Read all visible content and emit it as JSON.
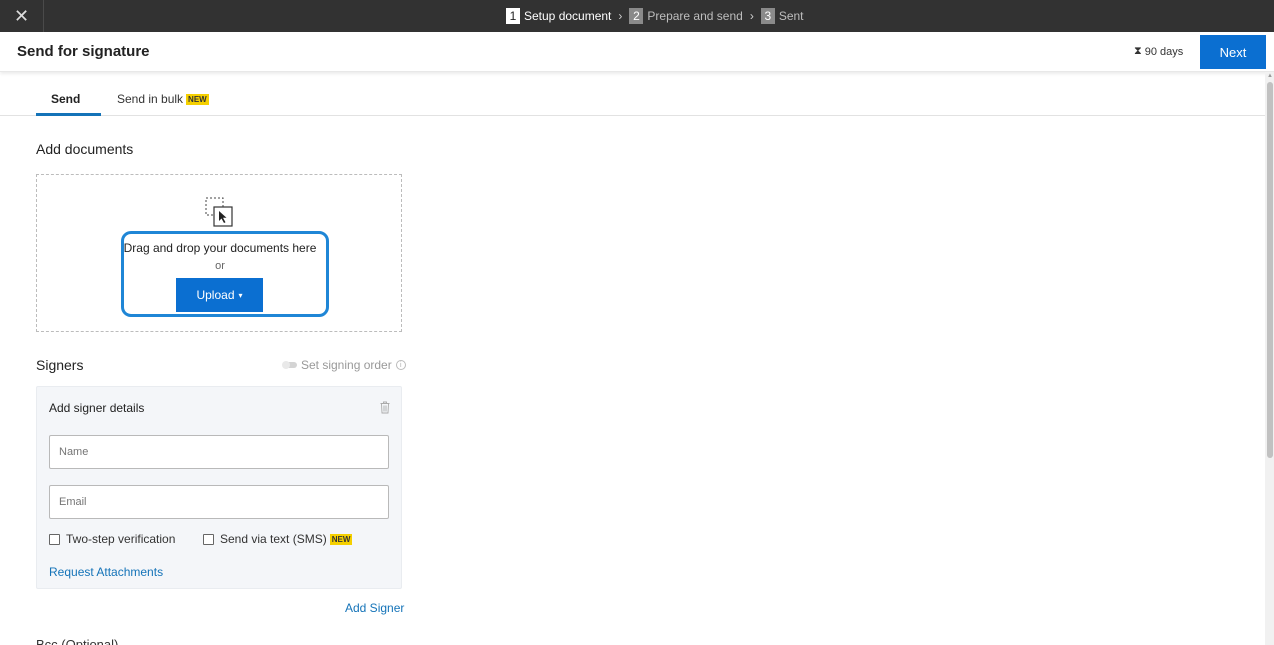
{
  "topbar": {
    "close_icon": "close-icon",
    "steps": [
      {
        "num": "1",
        "label": "Setup document"
      },
      {
        "num": "2",
        "label": "Prepare and send"
      },
      {
        "num": "3",
        "label": "Sent"
      }
    ],
    "separator": "›"
  },
  "header": {
    "title": "Send for signature",
    "expiry_icon": "hourglass-icon",
    "expiry": "90 days",
    "next_label": "Next"
  },
  "tabs": {
    "send": "Send",
    "bulk": "Send in bulk",
    "new_badge": "NEW"
  },
  "add_documents": {
    "title": "Add documents",
    "drop_text": "Drag and drop your documents here",
    "or": "or",
    "upload_label": "Upload",
    "upload_caret": "▾"
  },
  "signers": {
    "title": "Signers",
    "signing_order": "Set signing order",
    "info_icon": "i",
    "card_title": "Add signer details",
    "name_placeholder": "Name",
    "email_placeholder": "Email",
    "two_step": "Two-step verification",
    "sms": "Send via text (SMS)",
    "new_badge": "NEW",
    "request_attachments": "Request Attachments",
    "add_signer": "Add Signer"
  },
  "bottom_section": "Bcc (Optional)",
  "colors": {
    "accent": "#0b6fd1",
    "link": "#1473b8",
    "topbar": "#323232",
    "badge": "#f5d000"
  }
}
